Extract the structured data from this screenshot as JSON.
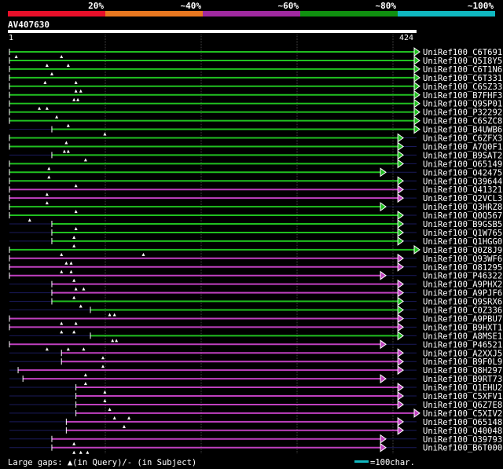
{
  "title": "AV407630",
  "query_length_start": "1",
  "query_length_end": "424",
  "scale": {
    "labels": [
      "20%",
      "~40%",
      "~60%",
      "~80%",
      "~100%"
    ],
    "colors": [
      "#e8102a",
      "#e87820",
      "#a02aa0",
      "#109010",
      "#10b8c0"
    ]
  },
  "colors": {
    "green": "#20c020",
    "magenta": "#c040c0",
    "grid": "#444444",
    "background": "#000000"
  },
  "legend": {
    "text": "Large gaps: ▲(in Query)/- (in Subject)",
    "scale_text": "=100char."
  },
  "chart_data": {
    "type": "alignment",
    "query_length": 424,
    "hits": [
      {
        "name": "UniRef100_C6T691",
        "start": 1,
        "end": 436,
        "color": "green",
        "gaps": [
          55,
          8
        ]
      },
      {
        "name": "UniRef100_Q5I8Y5",
        "start": 1,
        "end": 436,
        "color": "green",
        "gaps": [
          40,
          62
        ]
      },
      {
        "name": "UniRef100_C6T1N6",
        "start": 1,
        "end": 436,
        "color": "green",
        "gaps": [
          45
        ]
      },
      {
        "name": "UniRef100_C6T331",
        "start": 1,
        "end": 436,
        "color": "green",
        "gaps": [
          38,
          70
        ]
      },
      {
        "name": "UniRef100_C6SZ33",
        "start": 1,
        "end": 436,
        "color": "green",
        "gaps": [
          70,
          75
        ]
      },
      {
        "name": "UniRef100_B7FHF3",
        "start": 1,
        "end": 436,
        "color": "green",
        "gaps": [
          68,
          72
        ]
      },
      {
        "name": "UniRef100_Q9SP01",
        "start": 1,
        "end": 436,
        "color": "green",
        "gaps": [
          32,
          40
        ]
      },
      {
        "name": "UniRef100_P32292",
        "start": 1,
        "end": 436,
        "color": "green",
        "gaps": [
          50
        ]
      },
      {
        "name": "UniRef100_C6SZC8",
        "start": 1,
        "end": 436,
        "color": "green",
        "gaps": [
          62
        ]
      },
      {
        "name": "UniRef100_B4UWB6",
        "start": 45,
        "end": 436,
        "color": "green",
        "gaps": [
          100
        ]
      },
      {
        "name": "UniRef100_C6ZFX3",
        "start": 1,
        "end": 408,
        "color": "green",
        "gaps": [
          60
        ]
      },
      {
        "name": "UniRef100_A7Q0F1",
        "start": 1,
        "end": 408,
        "color": "green",
        "gaps": [
          58,
          62
        ]
      },
      {
        "name": "UniRef100_B9SAT2",
        "start": 45,
        "end": 408,
        "color": "green",
        "gaps": [
          80
        ]
      },
      {
        "name": "UniRef100_O65149",
        "start": 1,
        "end": 408,
        "color": "green",
        "gaps": [
          42
        ]
      },
      {
        "name": "UniRef100_O42475",
        "start": 1,
        "end": 390,
        "color": "green",
        "gaps": [
          42
        ]
      },
      {
        "name": "UniRef100_Q39644",
        "start": 1,
        "end": 408,
        "color": "green",
        "gaps": [
          70
        ]
      },
      {
        "name": "UniRef100_Q41321",
        "start": 1,
        "end": 408,
        "color": "magenta",
        "gaps": [
          40
        ]
      },
      {
        "name": "UniRef100_Q2VCL3",
        "start": 1,
        "end": 408,
        "color": "magenta",
        "gaps": [
          40
        ]
      },
      {
        "name": "UniRef100_Q3HRZ8",
        "start": 1,
        "end": 390,
        "color": "green",
        "gaps": [
          70
        ]
      },
      {
        "name": "UniRef100_Q0Q567",
        "start": 1,
        "end": 408,
        "color": "green",
        "gaps": [
          22
        ]
      },
      {
        "name": "UniRef100_B9GSB5",
        "start": 45,
        "end": 408,
        "color": "green",
        "gaps": [
          70
        ]
      },
      {
        "name": "UniRef100_Q1W765",
        "start": 45,
        "end": 408,
        "color": "green",
        "gaps": [
          68
        ]
      },
      {
        "name": "UniRef100_Q1HGG0",
        "start": 45,
        "end": 408,
        "color": "green",
        "gaps": [
          68
        ]
      },
      {
        "name": "UniRef100_Q0Z8J9",
        "start": 1,
        "end": 436,
        "color": "green",
        "gaps": [
          55,
          140
        ]
      },
      {
        "name": "UniRef100_Q93WF6",
        "start": 1,
        "end": 408,
        "color": "magenta",
        "gaps": [
          60,
          65
        ]
      },
      {
        "name": "UniRef100_O81295",
        "start": 1,
        "end": 408,
        "color": "magenta",
        "gaps": [
          55,
          65
        ]
      },
      {
        "name": "UniRef100_P46322",
        "start": 1,
        "end": 390,
        "color": "magenta",
        "gaps": [
          68
        ]
      },
      {
        "name": "UniRef100_A9PHX2",
        "start": 45,
        "end": 408,
        "color": "magenta",
        "gaps": [
          70,
          78
        ]
      },
      {
        "name": "UniRef100_A9PJF6",
        "start": 45,
        "end": 408,
        "color": "magenta",
        "gaps": [
          68
        ]
      },
      {
        "name": "UniRef100_Q9SRX6",
        "start": 45,
        "end": 408,
        "color": "green",
        "gaps": [
          75
        ]
      },
      {
        "name": "UniRef100_C0Z336",
        "start": 85,
        "end": 408,
        "color": "green",
        "gaps": [
          105,
          110
        ]
      },
      {
        "name": "UniRef100_A9PBU7",
        "start": 1,
        "end": 408,
        "color": "magenta",
        "gaps": [
          55,
          70
        ]
      },
      {
        "name": "UniRef100_B9HXT1",
        "start": 1,
        "end": 408,
        "color": "magenta",
        "gaps": [
          55,
          68
        ]
      },
      {
        "name": "UniRef100_A8MSE1",
        "start": 85,
        "end": 408,
        "color": "green",
        "gaps": [
          108,
          112
        ]
      },
      {
        "name": "UniRef100_P46521",
        "start": 1,
        "end": 390,
        "color": "magenta",
        "gaps": [
          40,
          62,
          78
        ]
      },
      {
        "name": "UniRef100_A2XXJ5",
        "start": 55,
        "end": 408,
        "color": "magenta",
        "gaps": [
          98
        ]
      },
      {
        "name": "UniRef100_B9F0L9",
        "start": 55,
        "end": 408,
        "color": "magenta",
        "gaps": [
          98
        ]
      },
      {
        "name": "UniRef100_Q8H297",
        "start": 10,
        "end": 408,
        "color": "magenta",
        "gaps": [
          80
        ]
      },
      {
        "name": "UniRef100_B9RT73",
        "start": 15,
        "end": 390,
        "color": "magenta",
        "gaps": [
          80
        ]
      },
      {
        "name": "UniRef100_Q1EHU2",
        "start": 70,
        "end": 408,
        "color": "magenta",
        "gaps": [
          100
        ]
      },
      {
        "name": "UniRef100_C5XFV1",
        "start": 70,
        "end": 408,
        "color": "magenta",
        "gaps": [
          100
        ]
      },
      {
        "name": "UniRef100_Q6Z7E8",
        "start": 70,
        "end": 408,
        "color": "magenta",
        "gaps": [
          105
        ]
      },
      {
        "name": "UniRef100_C5XIV2",
        "start": 70,
        "end": 436,
        "color": "magenta",
        "gaps": [
          110,
          125
        ]
      },
      {
        "name": "UniRef100_O65148",
        "start": 60,
        "end": 408,
        "color": "magenta",
        "gaps": [
          120
        ]
      },
      {
        "name": "UniRef100_Q40048",
        "start": 60,
        "end": 408,
        "color": "magenta",
        "gaps": []
      },
      {
        "name": "UniRef100_O39793",
        "start": 45,
        "end": 390,
        "color": "magenta",
        "gaps": [
          68
        ]
      },
      {
        "name": "UniRef100_B6T000",
        "start": 45,
        "end": 390,
        "color": "magenta",
        "gaps": [
          68,
          75,
          82
        ]
      }
    ]
  }
}
